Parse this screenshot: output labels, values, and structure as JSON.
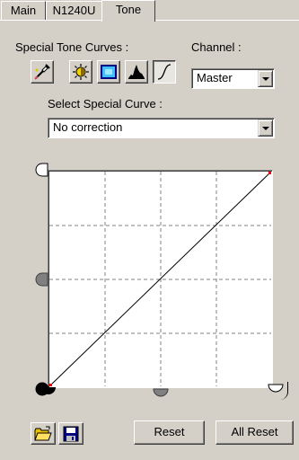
{
  "tabs": [
    {
      "label": "Main",
      "active": false
    },
    {
      "label": "N1240U",
      "active": false
    },
    {
      "label": "Tone",
      "active": true
    }
  ],
  "special_tone_curves_label": "Special Tone Curves :",
  "channel": {
    "label": "Channel :",
    "selected": "Master"
  },
  "tone_buttons": [
    {
      "icon": "eyedropper-icon"
    },
    {
      "icon": "brightness-icon"
    },
    {
      "icon": "contrast-icon"
    },
    {
      "icon": "histogram-icon"
    },
    {
      "icon": "tone-curve-icon",
      "pressed": true
    }
  ],
  "select_curve": {
    "label": "Select Special Curve :",
    "selected": "No correction"
  },
  "buttons": {
    "reset": "Reset",
    "all_reset": "All Reset"
  },
  "bottom_icons": [
    "open-folder-icon",
    "save-disk-icon"
  ],
  "colors": {
    "background": "#d4d0c8",
    "curve_endpoint": "#ff0000"
  }
}
